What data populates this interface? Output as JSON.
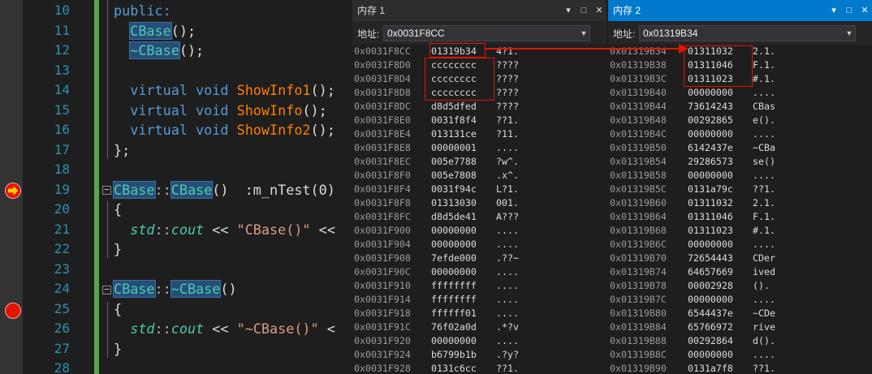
{
  "editor": {
    "line_numbers": [
      "10",
      "11",
      "12",
      "13",
      "14",
      "15",
      "16",
      "17",
      "18",
      "19",
      "20",
      "21",
      "22",
      "23",
      "24",
      "25",
      "26",
      "27",
      "28"
    ],
    "lines": [
      [
        {
          "t": "public:",
          "c": "kw"
        }
      ],
      [
        {
          "t": "  "
        },
        {
          "t": "CBase",
          "c": "ns hl"
        },
        {
          "t": "();"
        }
      ],
      [
        {
          "t": "  "
        },
        {
          "t": "~CBase",
          "c": "ns hl"
        },
        {
          "t": "();"
        }
      ],
      [],
      [
        {
          "t": "  "
        },
        {
          "t": "virtual",
          "c": "kw"
        },
        {
          "t": " "
        },
        {
          "t": "void",
          "c": "kw"
        },
        {
          "t": " "
        },
        {
          "t": "ShowInfo1",
          "c": "fn"
        },
        {
          "t": "();"
        }
      ],
      [
        {
          "t": "  "
        },
        {
          "t": "virtual",
          "c": "kw"
        },
        {
          "t": " "
        },
        {
          "t": "void",
          "c": "kw"
        },
        {
          "t": " "
        },
        {
          "t": "ShowInfo",
          "c": "fn"
        },
        {
          "t": "();"
        }
      ],
      [
        {
          "t": "  "
        },
        {
          "t": "virtual",
          "c": "kw"
        },
        {
          "t": " "
        },
        {
          "t": "void",
          "c": "kw"
        },
        {
          "t": " "
        },
        {
          "t": "ShowInfo2",
          "c": "fn"
        },
        {
          "t": "();"
        }
      ],
      [
        {
          "t": "};"
        }
      ],
      [],
      [
        {
          "t": "CBase",
          "c": "ns hl"
        },
        {
          "t": "::",
          "c": "op"
        },
        {
          "t": "CBase",
          "c": "ns hl"
        },
        {
          "t": "()  :m_nTest(0)"
        }
      ],
      [
        {
          "t": "{"
        }
      ],
      [
        {
          "t": "  "
        },
        {
          "t": "std",
          "c": "ns it"
        },
        {
          "t": "::",
          "c": "op"
        },
        {
          "t": "cout",
          "c": "ns it"
        },
        {
          "t": " << "
        },
        {
          "t": "\"CBase()\"",
          "c": "st"
        },
        {
          "t": " <<"
        }
      ],
      [
        {
          "t": "}"
        }
      ],
      [],
      [
        {
          "t": "CBase",
          "c": "ns hl"
        },
        {
          "t": "::",
          "c": "op"
        },
        {
          "t": "~CBase",
          "c": "ns hl"
        },
        {
          "t": "()"
        }
      ],
      [
        {
          "t": "{"
        }
      ],
      [
        {
          "t": "  "
        },
        {
          "t": "std",
          "c": "ns it"
        },
        {
          "t": "::",
          "c": "op"
        },
        {
          "t": "cout",
          "c": "ns it"
        },
        {
          "t": " << "
        },
        {
          "t": "\"~CBase()\"",
          "c": "st"
        },
        {
          "t": " <"
        }
      ],
      [
        {
          "t": "}"
        }
      ],
      []
    ]
  },
  "memory1": {
    "title": "内存 1",
    "address_label": "地址:",
    "address": "0x0031F8CC",
    "rows": [
      [
        "0x0031F8CC",
        "01319b34",
        "4?1."
      ],
      [
        "0x0031F8D0",
        "cccccccc",
        "????"
      ],
      [
        "0x0031F8D4",
        "cccccccc",
        "????"
      ],
      [
        "0x0031F8D8",
        "cccccccc",
        "????"
      ],
      [
        "0x0031F8DC",
        "d8d5dfed",
        "????"
      ],
      [
        "0x0031F8E0",
        "0031f8f4",
        "??1."
      ],
      [
        "0x0031F8E4",
        "013131ce",
        "?11."
      ],
      [
        "0x0031F8E8",
        "00000001",
        "...."
      ],
      [
        "0x0031F8EC",
        "005e7788",
        "?w^."
      ],
      [
        "0x0031F8F0",
        "005e7808",
        ".x^."
      ],
      [
        "0x0031F8F4",
        "0031f94c",
        "L?1."
      ],
      [
        "0x0031F8F8",
        "01313030",
        "001."
      ],
      [
        "0x0031F8FC",
        "d8d5de41",
        "A???"
      ],
      [
        "0x0031F900",
        "00000000",
        "...."
      ],
      [
        "0x0031F904",
        "00000000",
        "...."
      ],
      [
        "0x0031F908",
        "7efde000",
        ".??~"
      ],
      [
        "0x0031F90C",
        "00000000",
        "...."
      ],
      [
        "0x0031F910",
        "ffffffff",
        "...."
      ],
      [
        "0x0031F914",
        "ffffffff",
        "...."
      ],
      [
        "0x0031F918",
        "ffffff01",
        "...."
      ],
      [
        "0x0031F91C",
        "76f02a0d",
        ".*?v"
      ],
      [
        "0x0031F920",
        "00000000",
        "...."
      ],
      [
        "0x0031F924",
        "b6799b1b",
        ".?y?"
      ],
      [
        "0x0031F928",
        "0131c6cc",
        "??1."
      ]
    ]
  },
  "memory2": {
    "title": "内存 2",
    "address_label": "地址:",
    "address": "0x01319B34",
    "rows": [
      [
        "0x01319B34",
        "01311032",
        "2.1."
      ],
      [
        "0x01319B38",
        "01311046",
        "F.1."
      ],
      [
        "0x01319B3C",
        "01311023",
        "#.1."
      ],
      [
        "0x01319B40",
        "00000000",
        "...."
      ],
      [
        "0x01319B44",
        "73614243",
        "CBas"
      ],
      [
        "0x01319B48",
        "00292865",
        "e()."
      ],
      [
        "0x01319B4C",
        "00000000",
        "...."
      ],
      [
        "0x01319B50",
        "6142437e",
        "~CBa"
      ],
      [
        "0x01319B54",
        "29286573",
        "se()"
      ],
      [
        "0x01319B58",
        "00000000",
        "...."
      ],
      [
        "0x01319B5C",
        "0131a79c",
        "??1."
      ],
      [
        "0x01319B60",
        "01311032",
        "2.1."
      ],
      [
        "0x01319B64",
        "01311046",
        "F.1."
      ],
      [
        "0x01319B68",
        "01311023",
        "#.1."
      ],
      [
        "0x01319B6C",
        "00000000",
        "...."
      ],
      [
        "0x01319B70",
        "72654443",
        "CDer"
      ],
      [
        "0x01319B74",
        "64657669",
        "ived"
      ],
      [
        "0x01319B78",
        "00002928",
        "()."
      ],
      [
        "0x01319B7C",
        "00000000",
        "...."
      ],
      [
        "0x01319B80",
        "6544437e",
        "~CDe"
      ],
      [
        "0x01319B84",
        "65766972",
        "rive"
      ],
      [
        "0x01319B88",
        "00292864",
        "d()."
      ],
      [
        "0x01319B8C",
        "00000000",
        "...."
      ],
      [
        "0x01319B90",
        "0131a7f8",
        "??1."
      ]
    ]
  },
  "colors": {
    "accent": "#007acc",
    "breakpoint": "#e51400",
    "highlight_box": "#e51400"
  },
  "icons": [
    "breakpoint-icon",
    "current-statement-arrow-icon",
    "dropdown-chevron-icon",
    "pin-icon",
    "maximize-icon",
    "close-icon",
    "collapse-icon"
  ]
}
